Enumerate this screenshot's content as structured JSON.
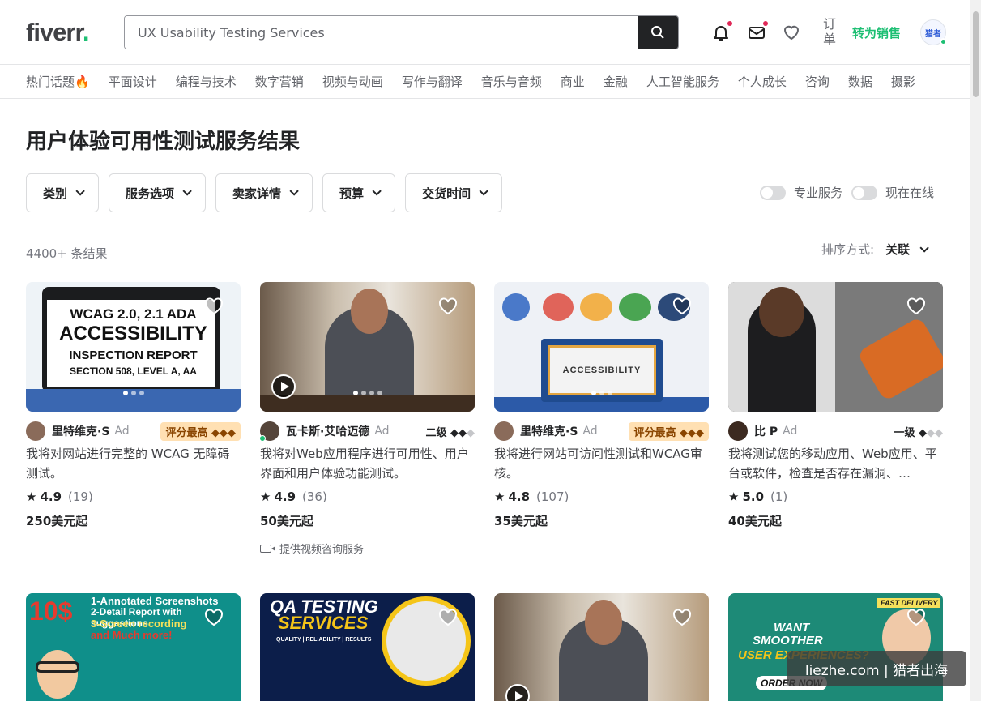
{
  "header": {
    "logo_text": "fiverr",
    "logo_dot": ".",
    "search_value": "UX Usability Testing Services",
    "orders_label": "订单",
    "become_seller": "转为销售",
    "avatar_text": "猎者"
  },
  "categories": [
    "热门话题🔥",
    "平面设计",
    "编程与技术",
    "数字营销",
    "视频与动画",
    "写作与翻译",
    "音乐与音频",
    "商业",
    "金融",
    "人工智能服务",
    "个人成长",
    "咨询",
    "数据",
    "摄影"
  ],
  "page": {
    "title_bold": "用户体验可用性测试服务",
    "title_rest": "结果",
    "result_count": "4400+ 条结果",
    "sort_label": "排序方式:",
    "sort_value": "关联"
  },
  "filters": [
    "类别",
    "服务选项",
    "卖家详情",
    "预算",
    "交货时间"
  ],
  "toggles": {
    "pro": "专业服务",
    "online": "现在在线"
  },
  "gigs": [
    {
      "seller": "里特维克·S",
      "ad": "Ad",
      "badge": "评分最高 ◆◆◆",
      "title": "我将对网站进行完整的 WCAG 无障碍测试。",
      "rating": "4.9",
      "reviews": "(19)",
      "price": "250美元起",
      "thumb_lines": [
        "WCAG 2.0, 2.1 ADA",
        "ACCESSIBILITY",
        "INSPECTION REPORT",
        "SECTION 508, LEVEL A, AA"
      ]
    },
    {
      "seller": "瓦卡斯·艾哈迈德",
      "ad": "Ad",
      "level": "二级",
      "title": "我将对Web应用程序进行可用性、用户界面和用户体验功能测试。",
      "rating": "4.9",
      "reviews": "(36)",
      "price": "50美元起",
      "video": "提供视频咨询服务"
    },
    {
      "seller": "里特维克·S",
      "ad": "Ad",
      "badge": "评分最高 ◆◆◆",
      "title": "我将进行网站可访问性测试和WCAG审核。",
      "rating": "4.8",
      "reviews": "(107)",
      "price": "35美元起",
      "thumb_lines": [
        "ACCESSIBILITY"
      ]
    },
    {
      "seller": "比 P",
      "ad": "Ad",
      "level": "一级",
      "title": "我将测试您的移动应用、Web应用、平台或软件，检查是否存在漏洞、…",
      "rating": "5.0",
      "reviews": "(1)",
      "price": "40美元起"
    }
  ],
  "row2_thumbs": {
    "a": [
      "10$",
      "1-Annotated Screenshots",
      "2-Detail Report with suggestions",
      "3-Screen recording",
      "and Much more!"
    ],
    "b": [
      "QA TESTING",
      "SERVICES",
      "QUALITY | RELIABILITY | RESULTS"
    ],
    "d": [
      "FAST DELIVERY",
      "WANT",
      "SMOOTHER",
      "USER EXPERIENCES?",
      "ORDER NOW"
    ]
  },
  "watermark": "liezhe.com | 猎者出海"
}
